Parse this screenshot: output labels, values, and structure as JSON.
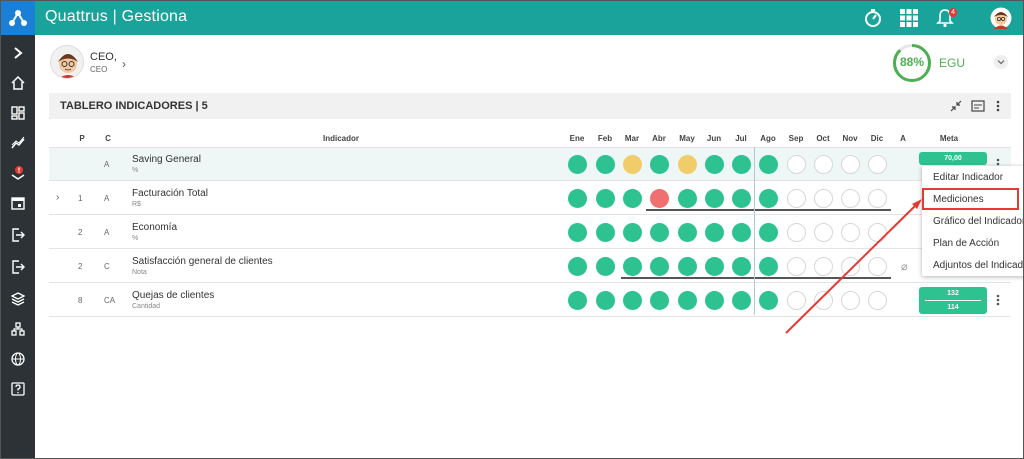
{
  "app": {
    "title": "Quattrus | Gestiona",
    "notification_count": "4"
  },
  "colors": {
    "topbar": "#1aa39a",
    "logo_bg": "#1a7fd6",
    "sidebar": "#2c3235",
    "green": "#2dc28f",
    "yellow": "#f0cd6a",
    "red": "#f07070",
    "yellow_meta": "#f0cd6a",
    "annotation": "#e53935"
  },
  "user": {
    "role": "CEO,",
    "sub": "CEO"
  },
  "egu": {
    "percent": "88%",
    "label": "EGU",
    "value": 0.88
  },
  "panel": {
    "title": "TABLERO INDICADORES | 5"
  },
  "table": {
    "headers": {
      "p": "P",
      "c": "C",
      "indicador": "Indicador",
      "a": "A",
      "meta": "Meta"
    },
    "months": [
      "Ene",
      "Feb",
      "Mar",
      "Abr",
      "May",
      "Jun",
      "Jul",
      "Ago",
      "Sep",
      "Oct",
      "Nov",
      "Dic"
    ],
    "rows": [
      {
        "p": "",
        "c": "A",
        "name": "Saving General",
        "unit": "%",
        "statuses": [
          "green",
          "green",
          "yellow",
          "green",
          "yellow",
          "green",
          "green",
          "green",
          "empty",
          "empty",
          "empty",
          "empty"
        ],
        "meta_top": "70,00",
        "meta_bottom": "",
        "has_chevron": false
      },
      {
        "p": "1",
        "c": "A",
        "name": "Facturación Total",
        "unit": "R$",
        "statuses": [
          "green",
          "green",
          "green",
          "red",
          "green",
          "green",
          "green",
          "green",
          "empty",
          "empty",
          "empty",
          "empty"
        ],
        "meta_top": "",
        "meta_bottom": "",
        "has_chevron": true
      },
      {
        "p": "2",
        "c": "A",
        "name": "Economía",
        "unit": "%",
        "statuses": [
          "green",
          "green",
          "green",
          "green",
          "green",
          "green",
          "green",
          "green",
          "empty",
          "empty",
          "empty",
          "empty"
        ],
        "meta_top": "",
        "meta_bottom": "",
        "has_chevron": false
      },
      {
        "p": "2",
        "c": "C",
        "name": "Satisfacción general de clientes",
        "unit": "Nota",
        "statuses": [
          "green",
          "green",
          "green",
          "green",
          "green",
          "green",
          "green",
          "green",
          "empty",
          "empty",
          "empty",
          "empty"
        ],
        "meta_top": "",
        "meta_bottom": "",
        "has_chevron": false
      },
      {
        "p": "8",
        "c": "CA",
        "name": "Quejas de clientes",
        "unit": "Cantidad",
        "statuses": [
          "green",
          "green",
          "green",
          "green",
          "green",
          "green",
          "green",
          "green",
          "empty",
          "empty",
          "empty",
          "empty"
        ],
        "meta_top": "132",
        "meta_bottom": "114",
        "has_chevron": false
      }
    ]
  },
  "context_menu": {
    "items": [
      "Editar Indicador",
      "Mediciones",
      "Gráfico del Indicador",
      "Plan de Acción",
      "Adjuntos del Indicador"
    ],
    "highlighted": "Mediciones"
  },
  "icons": {
    "topbar": [
      "stopwatch-icon",
      "apps-grid-icon",
      "bell-icon",
      "user-avatar-icon"
    ],
    "sidebar": [
      "chevron-right-icon",
      "home-icon",
      "dashboard-icon",
      "trend-icon",
      "alert-icon",
      "calendar-icon",
      "export-icon",
      "logout-icon",
      "layers-icon",
      "org-chart-icon",
      "globe-icon",
      "help-icon"
    ],
    "panel": [
      "compress-icon",
      "keyboard-icon",
      "more-vert-icon"
    ]
  }
}
